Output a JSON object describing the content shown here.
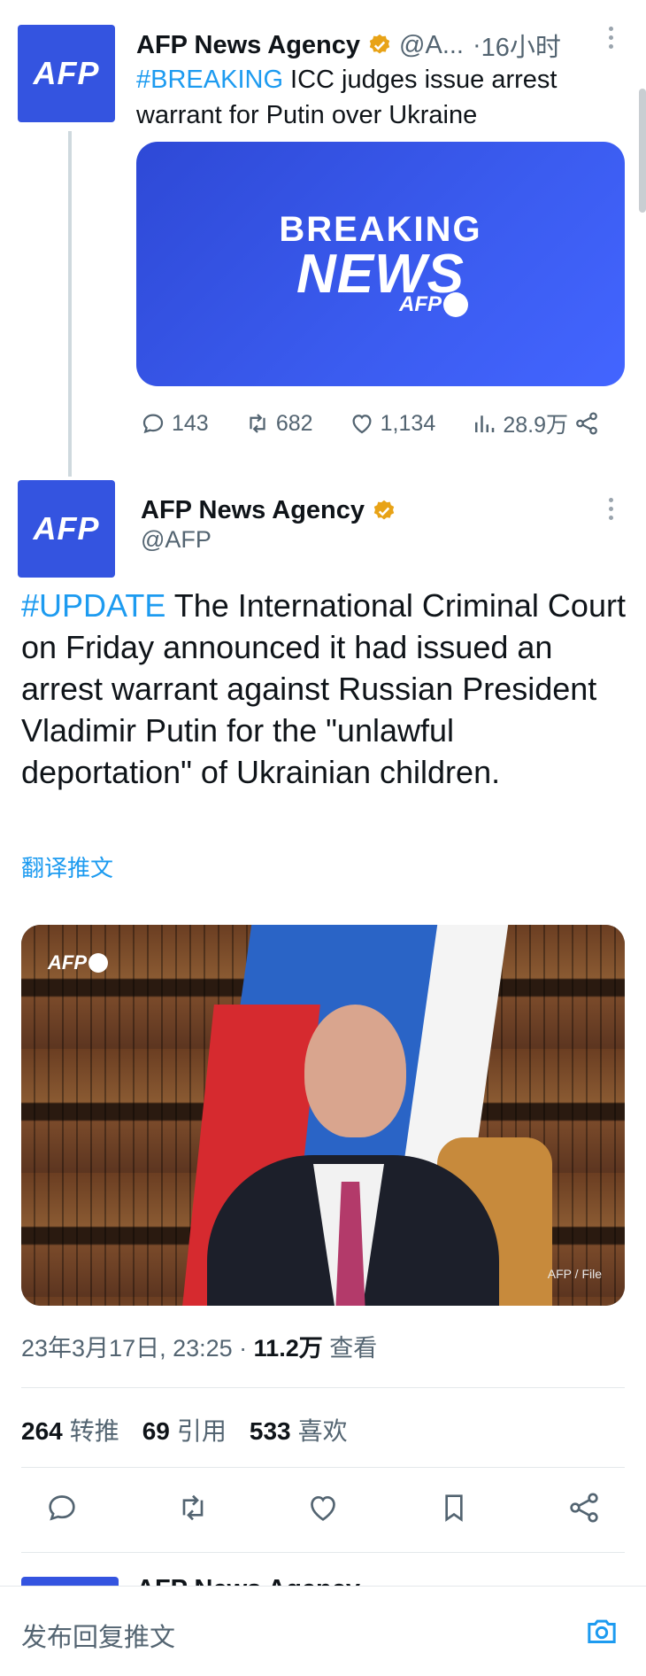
{
  "tweet1": {
    "avatar_text": "AFP",
    "name": "AFP News Agency",
    "handle_truncated": "@A...",
    "time": "16小时",
    "hashtag": "#BREAKING",
    "text": " ICC judges issue arrest warrant for Putin over Ukraine",
    "media": {
      "line1": "BREAKING",
      "line2": "NEWS",
      "logo": "AFP"
    },
    "actions": {
      "replies": "143",
      "retweets": "682",
      "likes": "1,134",
      "views": "28.9万"
    }
  },
  "tweet2": {
    "avatar_text": "AFP",
    "name": "AFP News Agency",
    "handle": "@AFP",
    "hashtag": "#UPDATE",
    "text": " The International Criminal Court on Friday announced it had issued an arrest warrant against Russian President Vladimir Putin for the \"unlawful deportation\" of Ukrainian children.",
    "translate_label": "翻译推文",
    "photo": {
      "logo": "AFP",
      "credit": "AFP / File"
    },
    "meta": {
      "datetime": "23年3月17日, 23:25",
      "separator": " · ",
      "views": "11.2万",
      "views_label": "查看"
    },
    "stats": [
      {
        "value": "264",
        "label": "转推"
      },
      {
        "value": "69",
        "label": "引用"
      },
      {
        "value": "533",
        "label": "喜欢"
      }
    ]
  },
  "next_tweet": {
    "name": "AFP News Agency"
  },
  "reply_bar": {
    "placeholder": "发布回复推文"
  },
  "colors": {
    "accent": "#1d9bf0",
    "brand_blue": "#3454e0",
    "verified": "#e8a317"
  },
  "icons": [
    "reply-icon",
    "retweet-icon",
    "like-icon",
    "views-icon",
    "share-icon",
    "bookmark-icon",
    "camera-icon",
    "verified-badge-icon",
    "more-icon"
  ]
}
